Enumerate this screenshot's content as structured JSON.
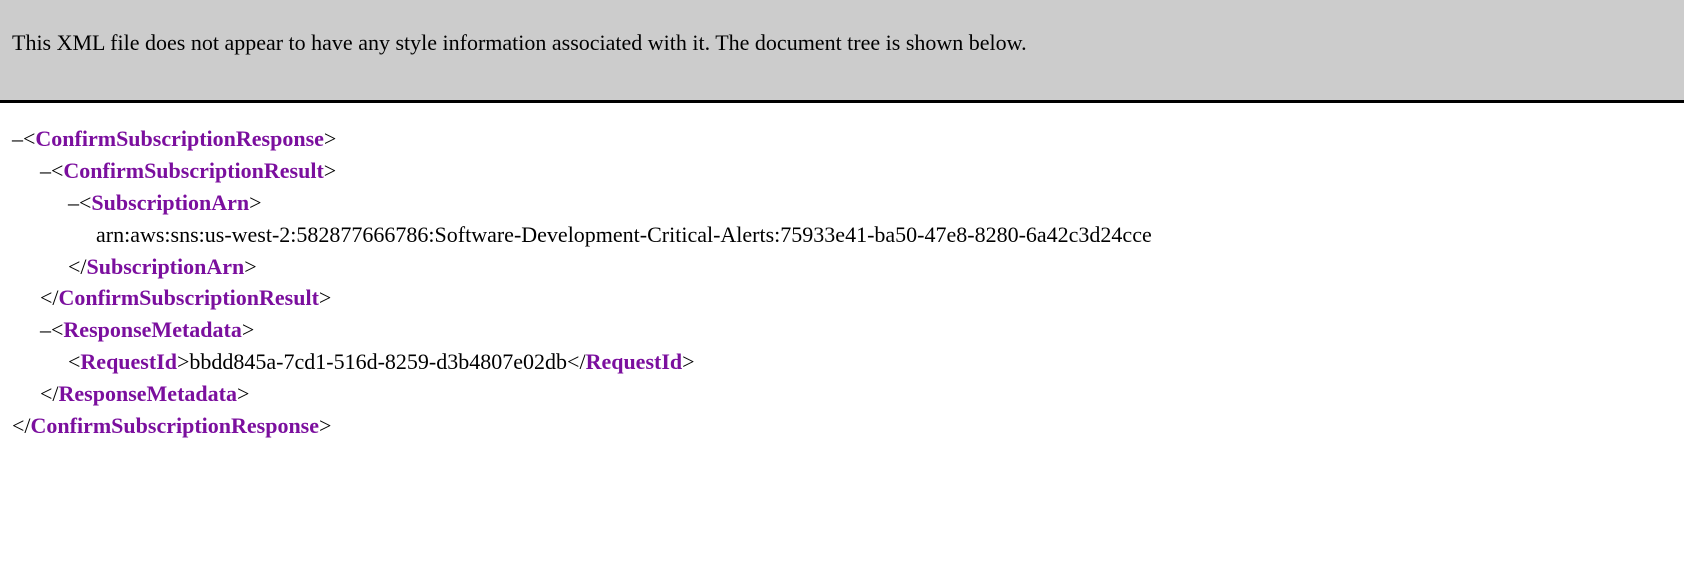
{
  "banner": {
    "message": "This XML file does not appear to have any style information associated with it. The document tree is shown below."
  },
  "xml": {
    "toggle": "–",
    "root": "ConfirmSubscriptionResponse",
    "result": "ConfirmSubscriptionResult",
    "subArn": "SubscriptionArn",
    "subArnValue": "arn:aws:sns:us-west-2:582877666786:Software-Development-Critical-Alerts:75933e41-ba50-47e8-8280-6a42c3d24cce",
    "metadata": "ResponseMetadata",
    "requestId": "RequestId",
    "requestIdValue": "bbdd845a-7cd1-516d-8259-d3b4807e02db"
  }
}
